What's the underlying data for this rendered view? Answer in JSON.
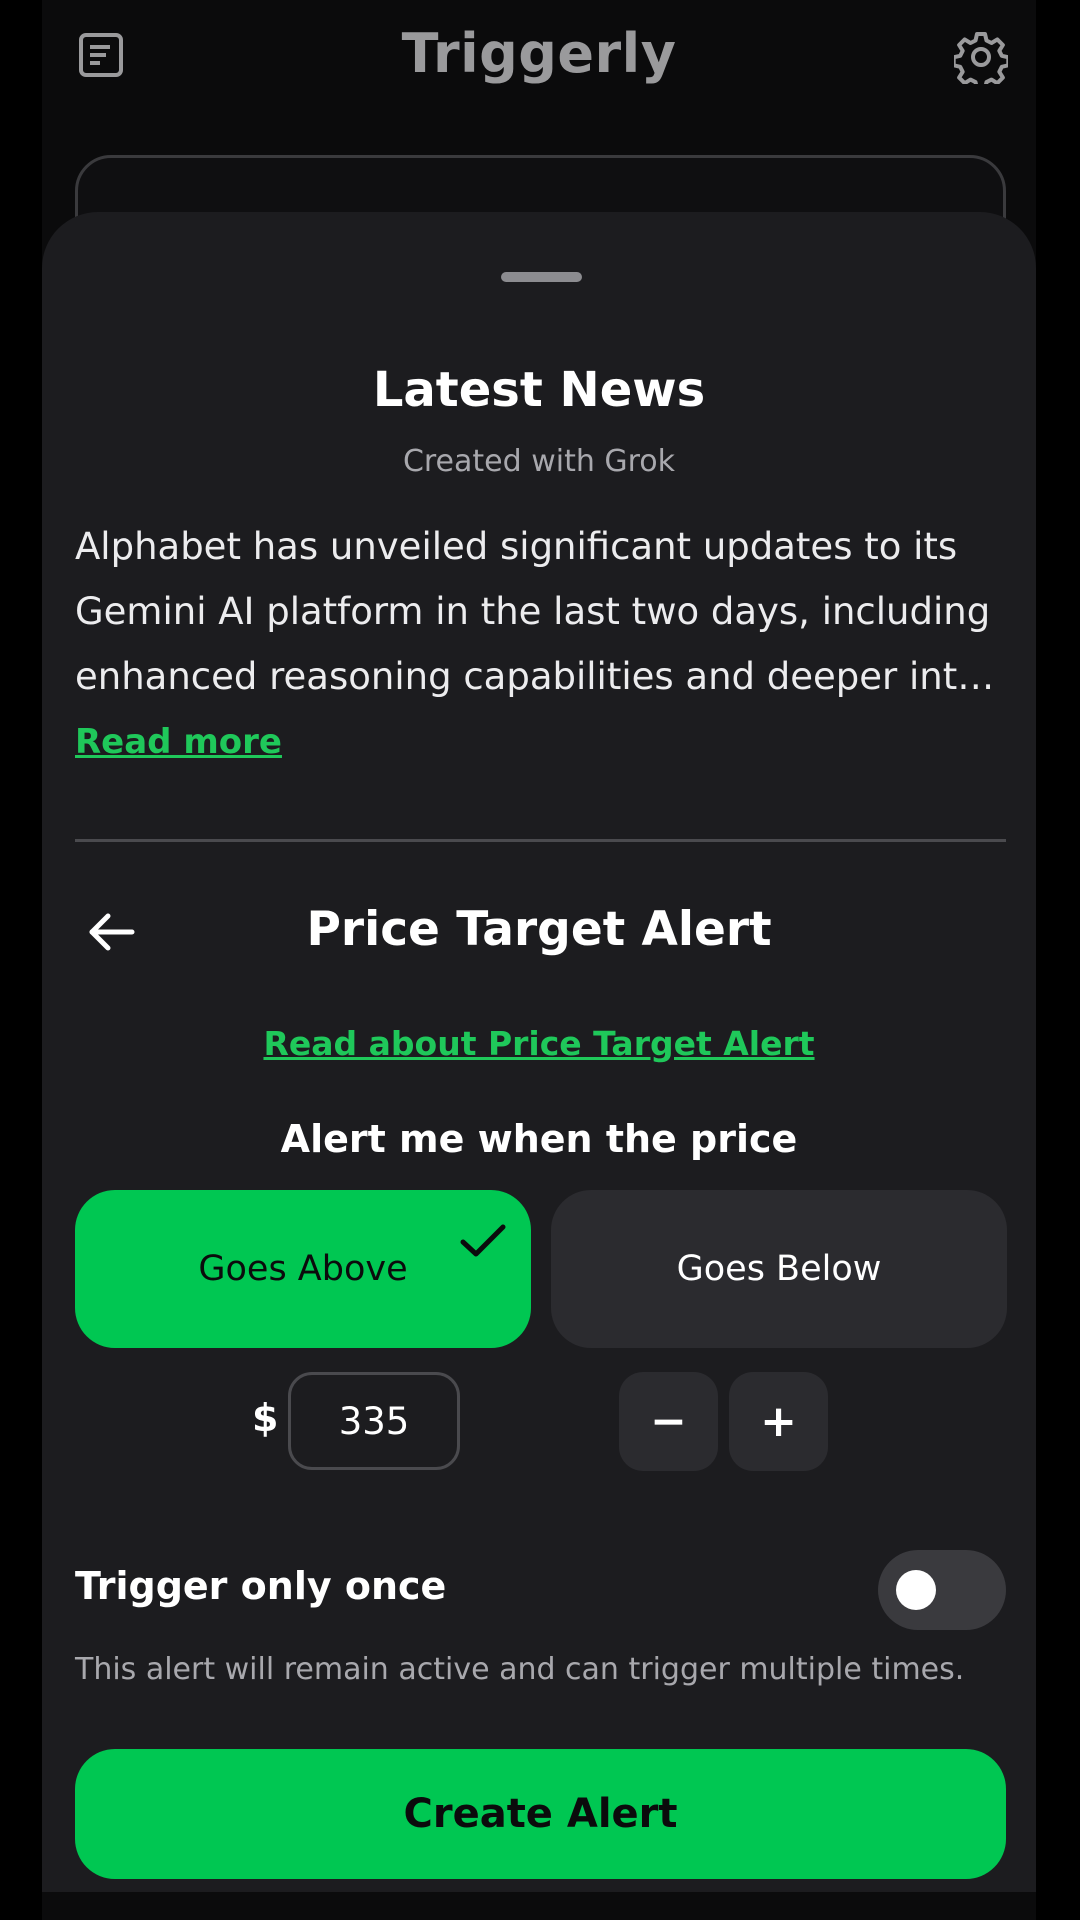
{
  "app": {
    "title": "Triggerly",
    "icons": {
      "left": "news-list-icon",
      "right": "gear-icon"
    }
  },
  "news": {
    "title": "Latest News",
    "subtitle": "Created with Grok",
    "body": "Alphabet has unveiled significant updates to its Gemini AI platform in the last two days, including enhanced reasoning capabilities and deeper int…",
    "read_more": "Read more"
  },
  "alert": {
    "title": "Price Target Alert",
    "read_about": "Read about Price Target Alert",
    "prompt": "Alert me when the price",
    "options": {
      "above": "Goes Above",
      "below": "Goes Below",
      "selected": "above"
    },
    "currency_symbol": "$",
    "price_value": "335",
    "minus": "−",
    "plus": "+",
    "trigger_once_label": "Trigger only once",
    "trigger_once_enabled": false,
    "trigger_help": "This alert will remain active and can trigger multiple times.",
    "create_label": "Create Alert"
  },
  "colors": {
    "accent": "#00c752",
    "link": "#1fc85a",
    "sheet_bg": "#1c1c1f",
    "card_bg": "#2b2b2f"
  }
}
